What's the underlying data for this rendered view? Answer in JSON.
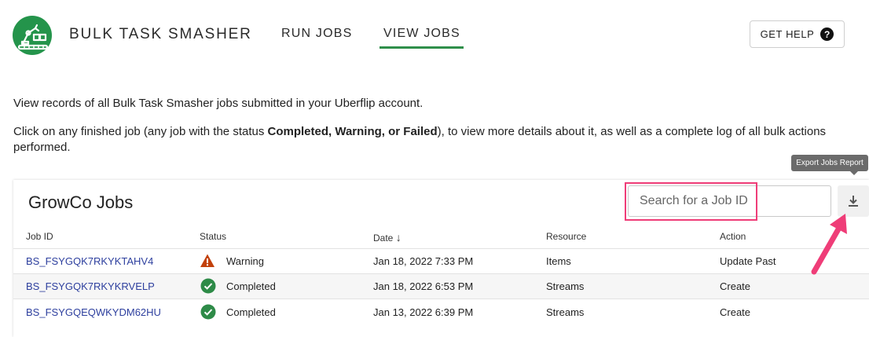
{
  "header": {
    "app_title": "BULK TASK SMASHER",
    "nav": [
      {
        "label": "RUN JOBS",
        "active": false
      },
      {
        "label": "VIEW JOBS",
        "active": true
      }
    ],
    "help_label": "GET HELP",
    "accent_color": "#2f8f4a"
  },
  "intro": {
    "line1": "View records of all Bulk Task Smasher jobs submitted in your Uberflip account.",
    "line2_prefix": "Click on any finished job (any job with the status ",
    "line2_bold": "Completed, Warning, or Failed",
    "line2_suffix": "), to view more details about it, as well as a complete log of all bulk actions performed."
  },
  "jobs": {
    "title": "GrowCo Jobs",
    "search_placeholder": "Search for a Job ID",
    "export_tooltip": "Export Jobs Report",
    "columns": [
      "Job ID",
      "Status",
      "Date",
      "Resource",
      "Action"
    ],
    "sort_indicator": "↓",
    "rows": [
      {
        "job_id": "BS_FSYGQK7RKYKTAHV4",
        "status": "Warning",
        "status_icon": "warning-icon",
        "date": "Jan 18, 2022 7:33 PM",
        "resource": "Items",
        "action": "Update Past"
      },
      {
        "job_id": "BS_FSYGQK7RKYKRVELP",
        "status": "Completed",
        "status_icon": "check-circle-icon",
        "date": "Jan 18, 2022 6:53 PM",
        "resource": "Streams",
        "action": "Create"
      },
      {
        "job_id": "BS_FSYGQEQWKYDM62HU",
        "status": "Completed",
        "status_icon": "check-circle-icon",
        "date": "Jan 13, 2022 6:39 PM",
        "resource": "Streams",
        "action": "Create"
      }
    ]
  },
  "colors": {
    "brand_green": "#24944b",
    "link_blue": "#2d3f9e",
    "highlight_pink": "#ef3d78",
    "warning_red": "#c2410c"
  }
}
